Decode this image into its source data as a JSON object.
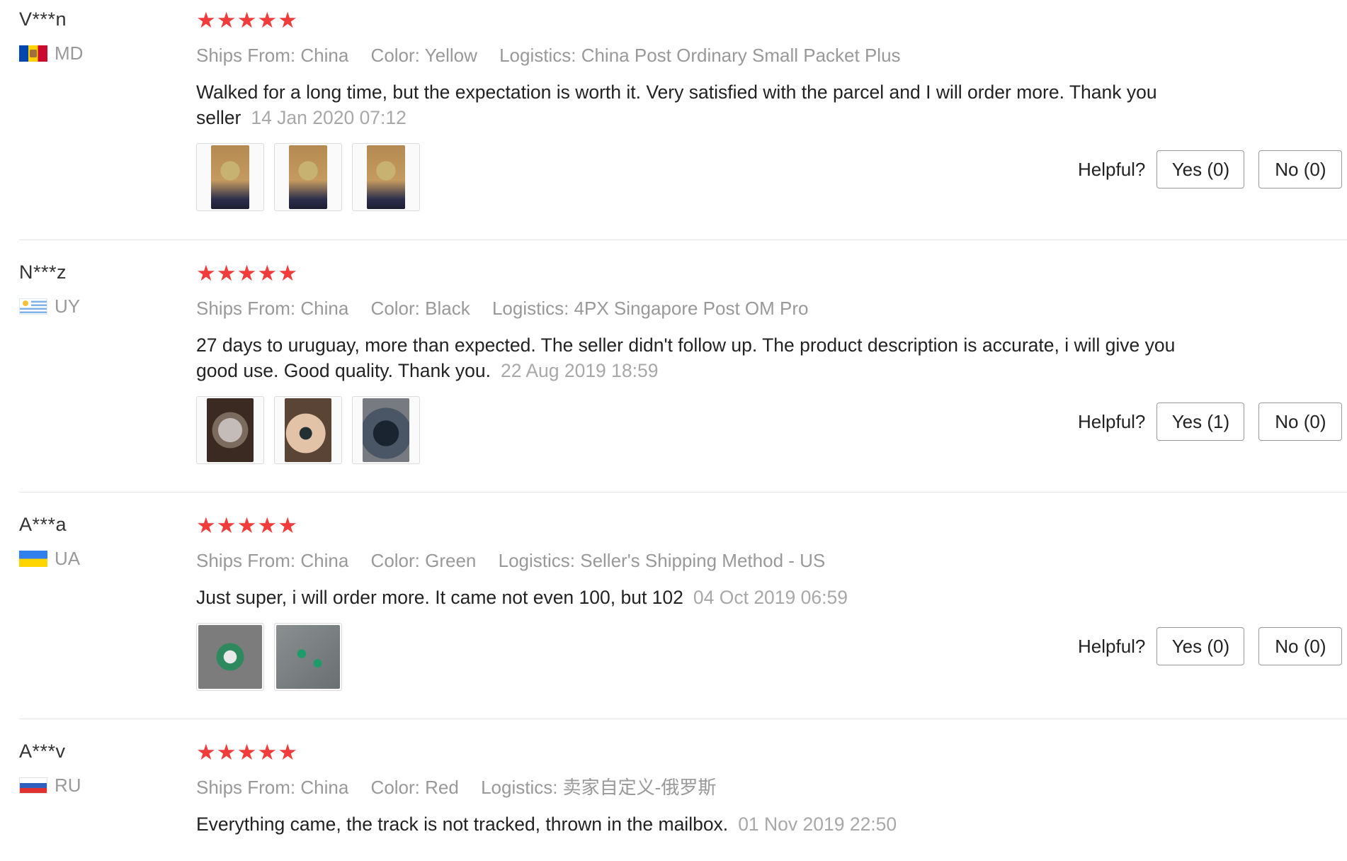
{
  "labels": {
    "helpful": "Helpful?"
  },
  "reviews": [
    {
      "user": "V***n",
      "country": "MD",
      "rating": 5,
      "ships_from": "Ships From: China",
      "color": "Color: Yellow",
      "logistics": "Logistics: China Post Ordinary Small Packet Plus",
      "text": "Walked for a long time, but the expectation is worth it. Very satisfied with the parcel and I will order more. Thank you seller",
      "date": "14 Jan 2020 07:12",
      "photo_count": 3,
      "yes": "Yes (0)",
      "no": "No (0)"
    },
    {
      "user": "N***z",
      "country": "UY",
      "rating": 5,
      "ships_from": "Ships From: China",
      "color": "Color: Black",
      "logistics": "Logistics: 4PX Singapore Post OM Pro",
      "text": "27 days to uruguay, more than expected. The seller didn't follow up. The product description is accurate, i will give you good use. Good quality. Thank you.",
      "date": "22 Aug 2019 18:59",
      "photo_count": 3,
      "yes": "Yes (1)",
      "no": "No (0)"
    },
    {
      "user": "A***a",
      "country": "UA",
      "rating": 5,
      "ships_from": "Ships From: China",
      "color": "Color: Green",
      "logistics": "Logistics: Seller's Shipping Method - US",
      "text": "Just super, i will order more. It came not even 100, but 102",
      "date": "04 Oct 2019 06:59",
      "photo_count": 2,
      "yes": "Yes (0)",
      "no": "No (0)"
    },
    {
      "user": "A***v",
      "country": "RU",
      "rating": 5,
      "ships_from": "Ships From: China",
      "color": "Color: Red",
      "logistics": "Logistics: 卖家自定义-俄罗斯",
      "text": "Everything came, the track is not tracked, thrown in the mailbox.",
      "date": "01 Nov 2019 22:50"
    }
  ],
  "star_glyph": "★",
  "colors": {
    "star": "#f23b3b",
    "meta_text": "#999999",
    "body_text": "#222222",
    "divider": "#e6e6e6"
  },
  "icons": {
    "star": "star-icon",
    "flag": "flag-icon",
    "photo": "review-photo"
  }
}
